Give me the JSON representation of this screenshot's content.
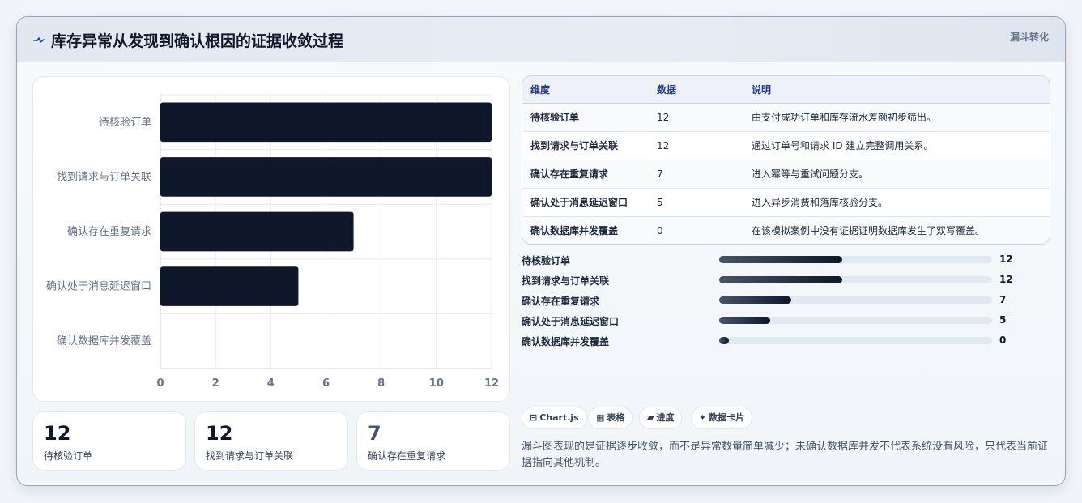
{
  "header": {
    "title": "库存异常从发现到确认根因的证据收敛过程",
    "badge": "漏斗转化",
    "icon": "pulse-icon"
  },
  "chart_data": {
    "type": "bar",
    "orientation": "horizontal",
    "categories": [
      "待核验订单",
      "找到请求与订单关联",
      "确认存在重复请求",
      "确认处于消息延迟窗口",
      "确认数据库并发覆盖"
    ],
    "values": [
      12,
      12,
      7,
      5,
      0
    ],
    "xlim": [
      0,
      12
    ],
    "xticks": [
      0,
      2,
      4,
      6,
      8,
      10,
      12
    ],
    "grid": true,
    "bar_color": "#0f172a",
    "title": "",
    "xlabel": "",
    "ylabel": ""
  },
  "stats": [
    {
      "value": "12",
      "label": "待核验订单"
    },
    {
      "value": "12",
      "label": "找到请求与订单关联"
    },
    {
      "value": "7",
      "label": "确认存在重复请求"
    }
  ],
  "table": {
    "headers": [
      "维度",
      "数据",
      "说明"
    ],
    "rows": [
      {
        "dim": "待核验订单",
        "value": "12",
        "desc": "由支付成功订单和库存流水差额初步筛出。"
      },
      {
        "dim": "找到请求与订单关联",
        "value": "12",
        "desc": "通过订单号和请求 ID 建立完整调用关系。"
      },
      {
        "dim": "确认存在重复请求",
        "value": "7",
        "desc": "进入幂等与重试问题分支。"
      },
      {
        "dim": "确认处于消息延迟窗口",
        "value": "5",
        "desc": "进入异步消费和落库核验分支。"
      },
      {
        "dim": "确认数据库并发覆盖",
        "value": "0",
        "desc": "在该模拟案例中没有证据证明数据库发生了双写覆盖。"
      }
    ]
  },
  "progress": {
    "max": 12,
    "items": [
      {
        "label": "待核验订单",
        "value": 12,
        "value_text": "12"
      },
      {
        "label": "找到请求与订单关联",
        "value": 12,
        "value_text": "12"
      },
      {
        "label": "确认存在重复请求",
        "value": 7,
        "value_text": "7"
      },
      {
        "label": "确认处于消息延迟窗口",
        "value": 5,
        "value_text": "5"
      },
      {
        "label": "确认数据库并发覆盖",
        "value": 0,
        "value_text": "0"
      }
    ]
  },
  "chips": [
    {
      "icon": "⊟",
      "icon_name": "chart-icon",
      "label": "Chart.js"
    },
    {
      "icon": "▦",
      "icon_name": "table-icon",
      "label": "表格"
    },
    {
      "icon": "▰",
      "icon_name": "progress-icon",
      "label": "进度"
    },
    {
      "icon": "✦",
      "icon_name": "card-icon",
      "label": "数据卡片"
    }
  ],
  "footnote": "漏斗图表现的是证据逐步收敛，而不是异常数量简单减少；未确认数据库并发不代表系统没有风险，只代表当前证据指向其他机制。"
}
